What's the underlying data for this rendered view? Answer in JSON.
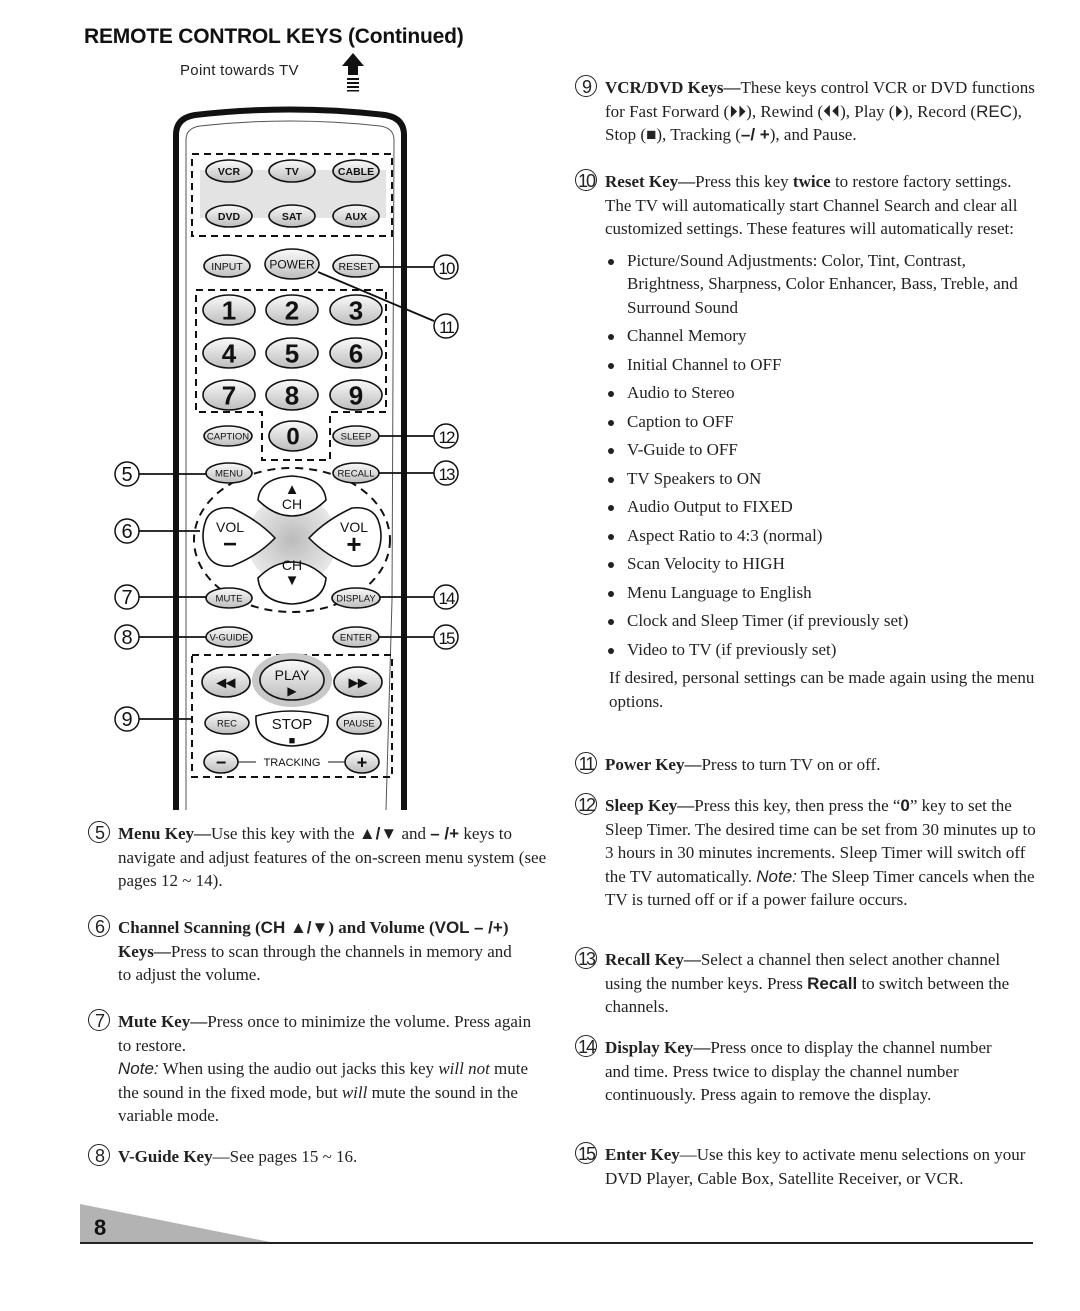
{
  "page": {
    "title": "REMOTE CONTROL KEYS (Continued)",
    "point_label": "Point towards TV",
    "page_number": "8"
  },
  "remote": {
    "mode_keys": [
      "VCR",
      "TV",
      "CABLE",
      "DVD",
      "SAT",
      "AUX"
    ],
    "top_keys": [
      "INPUT",
      "POWER",
      "RESET"
    ],
    "number_keys": [
      "1",
      "2",
      "3",
      "4",
      "5",
      "6",
      "7",
      "8",
      "9",
      "0"
    ],
    "caption": "CAPTION",
    "sleep": "SLEEP",
    "menu": "MENU",
    "recall": "RECALL",
    "ch": "CH",
    "vol": "VOL",
    "mute": "MUTE",
    "display": "DISPLAY",
    "vguide": "V-GUIDE",
    "enter": "ENTER",
    "play": "PLAY",
    "rec": "REC",
    "stop": "STOP",
    "pause": "PAUSE",
    "tracking": "TRACKING",
    "callouts": [
      "5",
      "6",
      "7",
      "8",
      "9",
      "10",
      "11",
      "12",
      "13",
      "14",
      "15"
    ]
  },
  "left_sections": [
    {
      "num": "5",
      "title": "Menu Key",
      "text_a": "Use this key with the ",
      "sym_a": "▲/▼",
      "text_b": " and ",
      "sym_b": "– /+",
      "text_c": " keys to navigate and adjust features of the on-screen menu system (see pages 12 ~ 14)."
    },
    {
      "num": "6",
      "title_a": "Channel Scanning (",
      "sym_a": "CH ▲/▼",
      "title_b": ") and Volume (",
      "sym_b": "VOL – /+",
      "title_c": ") Keys",
      "text": "Press to scan through the channels in memory and to adjust the volume."
    },
    {
      "num": "7",
      "title": "Mute Key",
      "text": "Press once to minimize the volume. Press again to restore.",
      "note_label": "Note:",
      "note_a": " When using the audio out jacks this key ",
      "note_em1": "will not",
      "note_b": " mute the sound in the fixed mode, but ",
      "note_em2": "will",
      "note_c": " mute the sound in the variable mode."
    },
    {
      "num": "8",
      "title": "V-Guide Key",
      "text": "See pages 15 ~ 16."
    }
  ],
  "right_sections": [
    {
      "num": "9",
      "title": "VCR/DVD Keys",
      "text": "These keys control VCR or DVD functions for Fast Forward (⏵⏵), Rewind (⏴⏴), Play (⏵),",
      "text2a": "Record (",
      "rec": "REC",
      "text2b": "), Stop (■), Tracking (",
      "trk": "–/ +",
      "text2c": "), and Pause."
    },
    {
      "num": "10",
      "title": "Reset Key",
      "text_a": "Press this key ",
      "bold": "twice",
      "text_b": " to restore factory settings. The TV will automatically start Channel Search and clear all customized settings. These features will automatically reset:",
      "items": [
        "Picture/Sound Adjustments: Color, Tint, Contrast, Brightness, Sharpness, Color Enhancer, Bass, Treble, and Surround Sound",
        "Channel Memory",
        "Initial Channel to OFF",
        "Audio to Stereo",
        "Caption to OFF",
        "V-Guide to OFF",
        "TV Speakers to ON",
        "Audio Output to FIXED",
        "Aspect Ratio to 4:3 (normal)",
        "Scan Velocity to HIGH",
        "Menu Language to English",
        "Clock and Sleep Timer (if previously set)",
        "Video to TV (if previously set)"
      ],
      "after": "If desired, personal settings can be made again using the menu options."
    },
    {
      "num": "11",
      "title": "Power Key",
      "text": "Press to turn TV on or off."
    },
    {
      "num": "12",
      "title": "Sleep Key",
      "text_a": "Press this key, then press the “",
      "key": "0",
      "text_b": "” key to set the Sleep Timer. The desired time can be set from 30 minutes up to 3 hours in 30 minutes increments. Sleep Timer will switch off the TV automatically.",
      "note_label": "Note:",
      "note": " The Sleep Timer cancels when the TV is turned off or if a power failure occurs."
    },
    {
      "num": "13",
      "title": "Recall Key",
      "text_a": "Select a channel then select another channel using the number keys. Press ",
      "key": "Recall",
      "text_b": " to switch between the channels."
    },
    {
      "num": "14",
      "title": "Display Key",
      "text": "Press once to display the channel number and time. Press twice to display the channel number continuously. Press again to remove the display."
    },
    {
      "num": "15",
      "title": "Enter Key",
      "text": "Use this key to activate menu selections on your DVD Player, Cable Box, Satellite Receiver, or VCR."
    }
  ],
  "colors": {
    "key_fill": "#d9d9d9",
    "body_fill": "#f2f2f2",
    "footer_tab": "#b3b3b3",
    "ink": "#1a1a1a"
  }
}
